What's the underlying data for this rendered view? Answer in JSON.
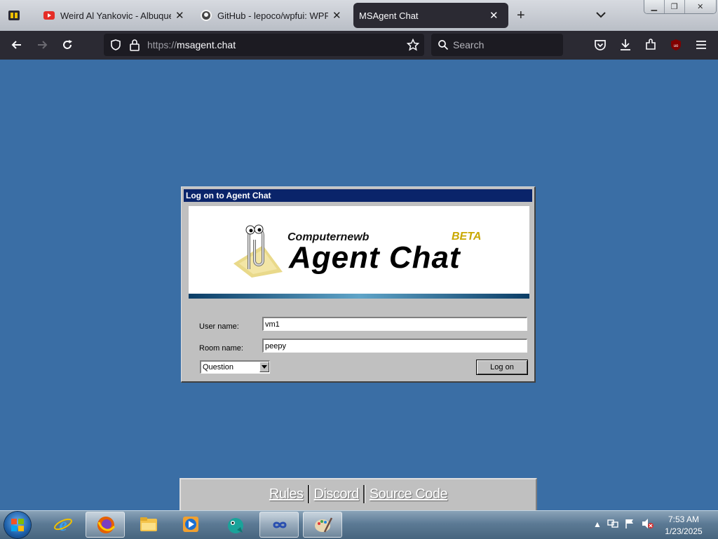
{
  "browser": {
    "tabs": [
      {
        "title": "Weird Al Yankovic - Albuquerque",
        "close": "✕"
      },
      {
        "title": "GitHub - lepoco/wpfui: WPF UI",
        "close": "✕"
      },
      {
        "title": "MSAgent Chat",
        "close": "✕",
        "active": true
      }
    ],
    "new_tab": "+",
    "url_scheme": "https://",
    "url_host": "msagent.chat",
    "search_placeholder": "Search"
  },
  "dialog": {
    "title": "Log on to Agent Chat",
    "banner": {
      "subtitle": "Computernewb",
      "main": "Agent Chat",
      "badge": "BETA"
    },
    "username_label": "User name:",
    "username_value": "vm1",
    "roomname_label": "Room name:",
    "roomname_value": "peepy",
    "agent_select": "Question",
    "logon_button": "Log on"
  },
  "footer": {
    "links": [
      "Rules",
      "Discord",
      "Source Code"
    ]
  },
  "taskbar": {
    "time": "7:53 AM",
    "date": "1/23/2025",
    "apps": [
      "internet-explorer-icon",
      "firefox-icon",
      "file-explorer-icon",
      "media-player-icon",
      "agent-icon",
      "infinity-icon",
      "paint-icon"
    ]
  },
  "colors": {
    "desktop_bg": "#3a6ea5",
    "title_bar": "#0a246a",
    "dialog_face": "#c0c0c0",
    "browser_dark": "#2b2a33"
  }
}
